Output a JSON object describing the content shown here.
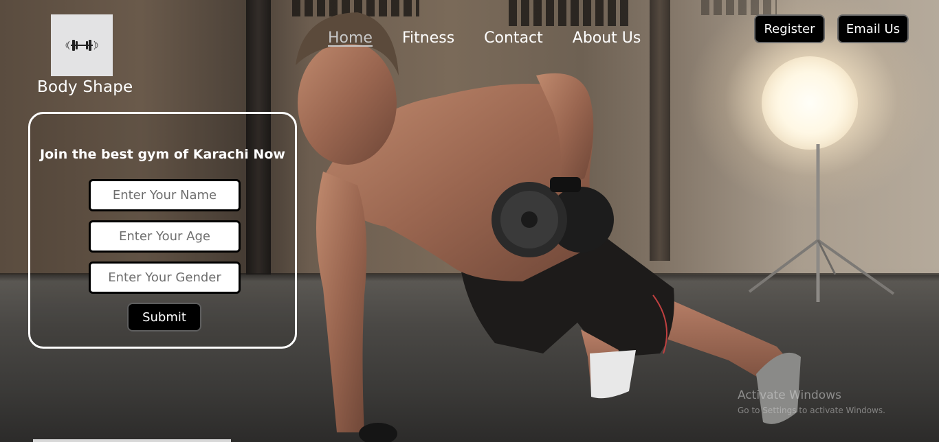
{
  "brand": {
    "name": "Body Shape",
    "logo_icon": "dumbbell-icon"
  },
  "nav": {
    "items": [
      {
        "label": "Home",
        "active": true
      },
      {
        "label": "Fitness",
        "active": false
      },
      {
        "label": "Contact",
        "active": false
      },
      {
        "label": "About Us",
        "active": false
      }
    ]
  },
  "header_buttons": {
    "register": "Register",
    "email": "Email Us"
  },
  "signup_form": {
    "title": "Join the best gym of Karachi Now",
    "name_placeholder": "Enter Your Name",
    "age_placeholder": "Enter Your Age",
    "gender_placeholder": "Enter Your Gender",
    "submit_label": "Submit"
  },
  "watermark": {
    "title": "Activate Windows",
    "subtitle": "Go to Settings to activate Windows."
  },
  "colors": {
    "button_bg": "#000000",
    "text": "#ffffff",
    "card_border": "#ffffff",
    "logo_bg": "#e3e3e4"
  }
}
